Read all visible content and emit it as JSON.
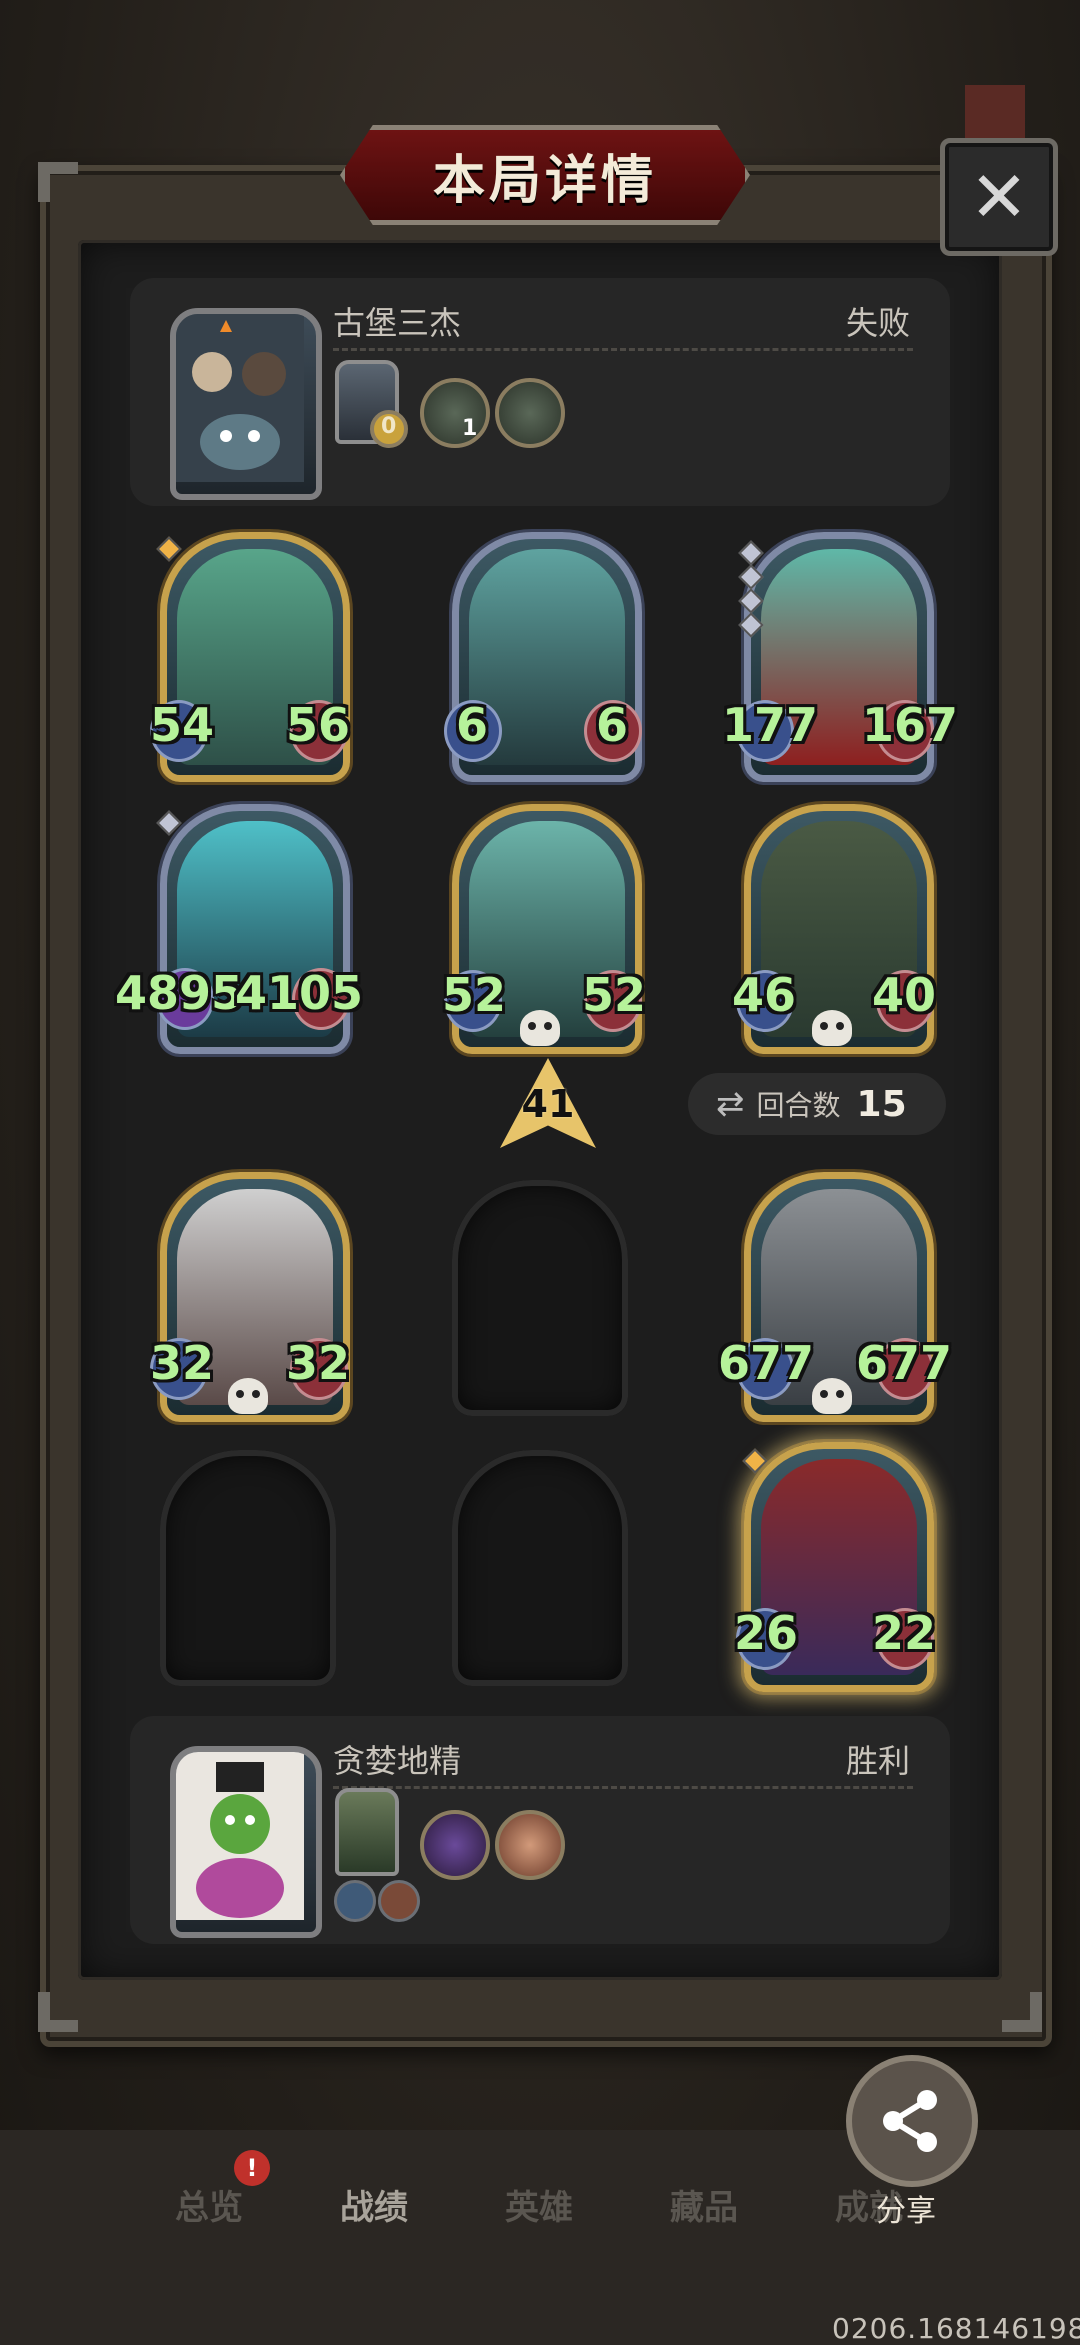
{
  "header": {
    "title": "本局详情",
    "close_icon": "close-icon"
  },
  "top_player": {
    "name": "古堡三杰",
    "result": "失败",
    "portrait_icon": "castle-trio-hero-portrait",
    "hero_card_level": "0",
    "trinket_level": "1"
  },
  "bottom_player": {
    "name": "贪婪地精",
    "result": "胜利",
    "portrait_icon": "greedy-goblin-hero-portrait"
  },
  "enemy_board": [
    {
      "name": "bearded-ghost-knight",
      "attack": "54",
      "health": "56",
      "frame": "gold",
      "gems": 1,
      "gem_color": "gold",
      "skull": false
    },
    {
      "name": "ghost-skeleton",
      "attack": "6",
      "health": "6",
      "frame": "silver",
      "gems": 0,
      "skull": false
    },
    {
      "name": "ghost-giant",
      "attack": "177",
      "health": "167",
      "frame": "silver",
      "gems": 4,
      "skull": false
    },
    {
      "name": "spectral-wolf",
      "attack": "4895",
      "health": "4105",
      "frame": "silver",
      "gems": 1,
      "skull": false
    },
    {
      "name": "ghost-skeleton-gold",
      "attack": "52",
      "health": "52",
      "frame": "gold",
      "gems": 0,
      "skull": true
    },
    {
      "name": "gypsy-witch",
      "attack": "46",
      "health": "40",
      "frame": "gold",
      "gems": 0,
      "skull": true
    }
  ],
  "player_board": [
    {
      "name": "bomb-knight",
      "attack": "32",
      "health": "32",
      "frame": "gold",
      "skull": true
    },
    {
      "name": "empty-slot-1",
      "empty": true
    },
    {
      "name": "bell-robot",
      "attack": "677",
      "health": "677",
      "frame": "gold",
      "skull": true
    },
    {
      "name": "empty-slot-2",
      "empty": true
    },
    {
      "name": "empty-slot-3",
      "empty": true
    },
    {
      "name": "jester-clown",
      "attack": "26",
      "health": "22",
      "frame": "gold",
      "glow": true,
      "skull": false
    }
  ],
  "level_badge": "41",
  "rounds": {
    "label": "回合数",
    "value": "15"
  },
  "nav": {
    "items": [
      "总览",
      "战绩",
      "英雄",
      "藏品",
      "成就"
    ],
    "active_index": 1,
    "notification": "!"
  },
  "share": {
    "label": "分享"
  },
  "build_id": "0206.168146198",
  "colors": {
    "stat_green": "#b6f29a",
    "gold_frame": "#c7a24c",
    "silver_frame": "#7f8aa6",
    "title_red": "#6e1313"
  }
}
